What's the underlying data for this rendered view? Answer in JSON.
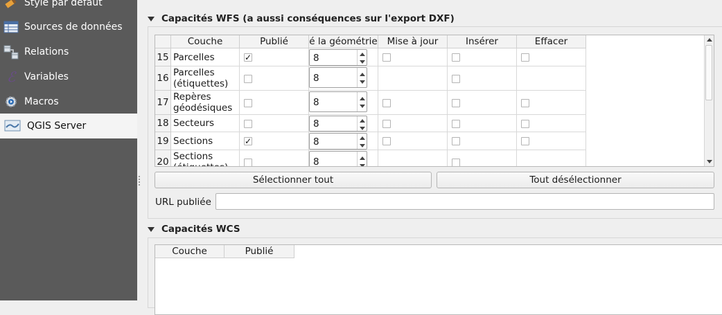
{
  "sidebar": {
    "items": [
      {
        "label": "Style par défaut",
        "icon": "paint-style-icon"
      },
      {
        "label": "Sources de données",
        "icon": "data-sources-icon"
      },
      {
        "label": "Relations",
        "icon": "relations-icon"
      },
      {
        "label": "Variables",
        "icon": "variables-icon"
      },
      {
        "label": "Macros",
        "icon": "macros-icon"
      },
      {
        "label": "QGIS Server",
        "icon": "qgis-server-icon",
        "selected": true
      }
    ]
  },
  "wfs": {
    "title": "Capacités WFS (a aussi conséquences sur l'export DXF)",
    "columns": [
      "Couche",
      "Publié",
      "é la géométrie",
      "Mise à jour",
      "Insérer",
      "Effacer"
    ],
    "rows": [
      {
        "num": "15",
        "layer": "Parcelles",
        "published": true,
        "precision": "8",
        "update": false,
        "insert": false,
        "delete": false,
        "update_shown": true,
        "delete_shown": true
      },
      {
        "num": "16",
        "layer": "Parcelles (étiquettes)",
        "published": false,
        "precision": "8",
        "update": false,
        "insert": false,
        "delete": false,
        "update_shown": false,
        "delete_shown": false
      },
      {
        "num": "17",
        "layer": "Repères géodésiques",
        "published": false,
        "precision": "8",
        "update": false,
        "insert": false,
        "delete": false,
        "update_shown": true,
        "delete_shown": true
      },
      {
        "num": "18",
        "layer": "Secteurs",
        "published": false,
        "precision": "8",
        "update": false,
        "insert": false,
        "delete": false,
        "update_shown": true,
        "delete_shown": true
      },
      {
        "num": "19",
        "layer": "Sections",
        "published": true,
        "precision": "8",
        "update": false,
        "insert": false,
        "delete": false,
        "update_shown": true,
        "delete_shown": true
      },
      {
        "num": "20",
        "layer": "Sections (étiquettes)",
        "published": false,
        "precision": "8",
        "update": false,
        "insert": false,
        "delete": false,
        "update_shown": false,
        "delete_shown": false
      }
    ],
    "select_all": "Sélectionner tout",
    "deselect_all": "Tout désélectionner",
    "url_label": "URL publiée",
    "url_value": ""
  },
  "wcs": {
    "title": "Capacités WCS",
    "columns": [
      "Couche",
      "Publié"
    ]
  },
  "colors": {
    "sidebar_bg": "#5a5a5a",
    "sidebar_selected_bg": "#f4f4f4",
    "window_bg": "#efefef"
  }
}
